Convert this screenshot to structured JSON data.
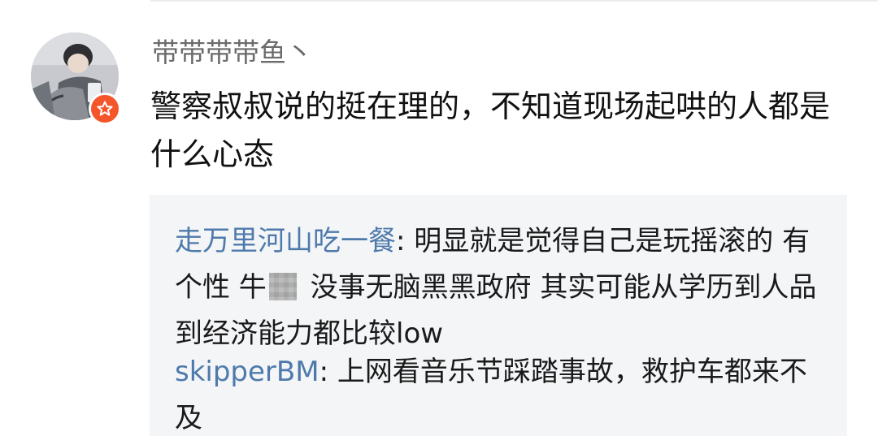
{
  "comment": {
    "username": "带带带带鱼丶",
    "text": "警察叔叔说的挺在理的，不知道现场起哄的人都是什么心态",
    "avatar_icon": "user-avatar",
    "badge_icon": "vip-star-icon",
    "badge_color": "#f5552b"
  },
  "replies": [
    {
      "author": "走万里河山吃一餐",
      "separator": ": ",
      "text_before": "明显就是觉得自己是玩摇滚的 有个性 牛",
      "censored_icon": "mosaic-blur",
      "text_after": " 没事无脑黑黑政府 其实可能从学历到人品到经济能力都比较low"
    },
    {
      "author": "skipperBM",
      "separator": ": ",
      "text": "上网看音乐节踩踏事故，救护车都来不及"
    }
  ],
  "colors": {
    "username": "#6b6b6b",
    "reply_author": "#4e7aab",
    "reply_background": "#f4f5f7"
  }
}
